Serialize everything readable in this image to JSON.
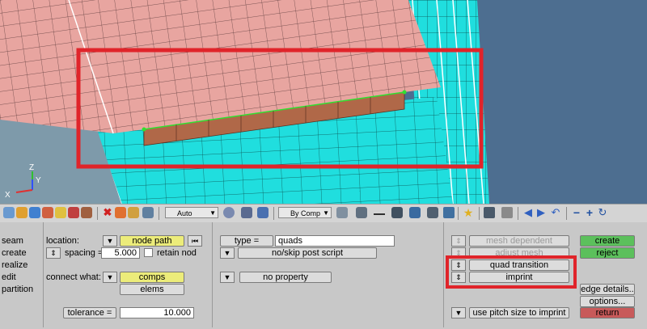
{
  "viewport": {
    "axis_labels": [
      "Z",
      "Y",
      "X"
    ],
    "colors": {
      "background": "#4d6e90",
      "pink_mesh": "#e8a5a0",
      "cyan_mesh": "#20dede",
      "brown_strip": "#b06848",
      "highlight": "#e0242a"
    }
  },
  "toolbar": {
    "icons": [
      "component-icon",
      "cube-icon",
      "folder-icon",
      "assembly-icon",
      "tag-icon",
      "layer-icon",
      "delete-icon",
      "shape-icon",
      "cut-icon",
      "color-icon",
      "view-icon",
      "cube-view-icon",
      "grid-icon",
      "line-icon",
      "solid-icon",
      "surface-icon",
      "screen-icon",
      "star-icon",
      "table-icon",
      "wrench-icon",
      "arrow-left-icon",
      "arrow-right-icon",
      "rotate-icon",
      "minus-icon",
      "plus-icon",
      "refresh-icon"
    ],
    "combo_auto": "Auto",
    "combo_bycomp": "By Comp"
  },
  "panel": {
    "modes": [
      "seam",
      "create",
      "realize",
      "edit",
      "partition"
    ],
    "location_label": "location:",
    "location_button": "node path",
    "spacing_label": "spacing =",
    "spacing_value": "5.000",
    "retain_label": "retain nod",
    "connect_label": "connect what:",
    "comps_button": "comps",
    "elems_button": "elems",
    "tolerance_label": "tolerance =",
    "tolerance_value": "10.000",
    "type_label": "type =",
    "type_value": "quads",
    "post_script": "no/skip post script",
    "property": "no property",
    "mesh_dependent": "mesh dependent",
    "adjust_mesh": "adjust mesh",
    "quad_transition": "quad transition",
    "imprint": "imprint",
    "pitch_size": "use pitch size to imprint",
    "create": "create",
    "reject": "reject",
    "edge_details": "edge details..",
    "options": "options...",
    "return": "return"
  }
}
